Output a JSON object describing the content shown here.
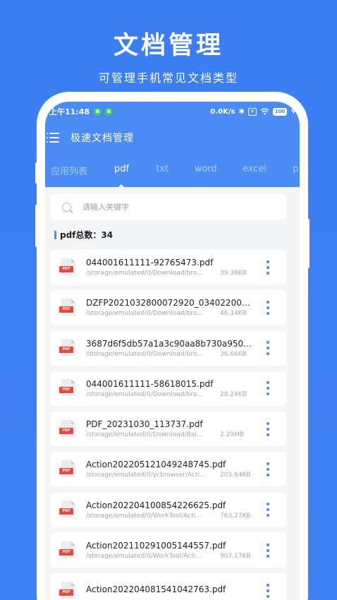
{
  "promo": {
    "title": "文档管理",
    "subtitle": "可管理手机常见文档类型"
  },
  "status_bar": {
    "time": "上午11:48",
    "network_speed": "0.0K/s",
    "battery": "100"
  },
  "toolbar": {
    "title": "极速文档管理",
    "menu_icon": "hamburger-menu-icon"
  },
  "tabs": [
    {
      "label": "应用列表",
      "active": false
    },
    {
      "label": "pdf",
      "active": true
    },
    {
      "label": "txt",
      "active": false
    },
    {
      "label": "word",
      "active": false
    },
    {
      "label": "excel",
      "active": false
    },
    {
      "label": "p",
      "active": false
    }
  ],
  "search": {
    "placeholder": "请输入关键字"
  },
  "summary": {
    "count_label": "pdf总数：34"
  },
  "files": [
    {
      "name": "044001611111-92765473.pdf",
      "path": "/storage/emulated/0/Download/bro...",
      "size": "39.38KB"
    },
    {
      "name": "DZFP2021032800072920_0340220001...",
      "path": "/storage/emulated/0/Download/bro...",
      "size": "46.14KB"
    },
    {
      "name": "3687d6f5db57a1a3c90aa8b730a950e...",
      "path": "/storage/emulated/0/Download/bro...",
      "size": "36.66KB"
    },
    {
      "name": "044001611111-58618015.pdf",
      "path": "/storage/emulated/0/Download/bro...",
      "size": "28.24KB"
    },
    {
      "name": "PDF_20231030_113737.pdf",
      "path": "/storage/emulated/0/Download/Bai...",
      "size": "2.29MB"
    },
    {
      "name": "Action202205121049248745.pdf",
      "path": "/storage/emulated/0/ycbrowser/Acti...",
      "size": "203.64KB"
    },
    {
      "name": "Action202204100854226625.pdf",
      "path": "/storage/emulated/0/WorkTool/Acti...",
      "size": "763.27KB"
    },
    {
      "name": "Action202110291005144557.pdf",
      "path": "/storage/emulated/0/WorkTool/Acti...",
      "size": "907.17KB"
    },
    {
      "name": "Action202204081541042763.pdf",
      "path": "",
      "size": ""
    }
  ],
  "file_icon": {
    "label": "PDF",
    "icon": "pdf-file-icon",
    "color": "#e8493c"
  },
  "colors": {
    "background": "#3f82f5",
    "appbar": "#4a8bf4",
    "accent": "#4a8bf4"
  }
}
